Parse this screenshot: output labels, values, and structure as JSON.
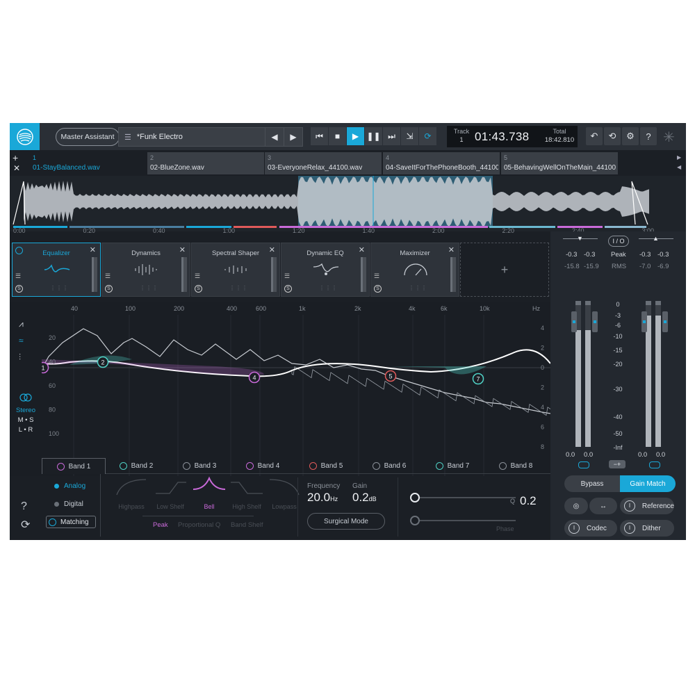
{
  "topbar": {
    "assistant_label": "Master Assistant",
    "preset_name": "*Funk Electro",
    "track_label": "Track",
    "track_num": "1",
    "time": "01:43.738",
    "total_label": "Total",
    "total_time": "18:42.810"
  },
  "tabs": [
    {
      "num": "1",
      "name": "01-StayBalanced.wav",
      "active": true
    },
    {
      "num": "2",
      "name": "02-BlueZone.wav"
    },
    {
      "num": "3",
      "name": "03-EveryoneRelax_44100.wav"
    },
    {
      "num": "4",
      "name": "04-SaveItForThePhoneBooth_44100..."
    },
    {
      "num": "5",
      "name": "05-BehavingWellOnTheMain_44100..."
    }
  ],
  "timeline": [
    "0:00",
    "0:20",
    "0:40",
    "1:00",
    "1:20",
    "1:40",
    "2:00",
    "2:20",
    "2:40",
    "3:00"
  ],
  "modules": [
    {
      "title": "Equalizer",
      "active": true
    },
    {
      "title": "Dynamics"
    },
    {
      "title": "Spectral Shaper"
    },
    {
      "title": "Dynamic EQ"
    },
    {
      "title": "Maximizer"
    }
  ],
  "add_module": "+",
  "eq": {
    "freq_labels": [
      "40",
      "100",
      "200",
      "400",
      "600",
      "1k",
      "2k",
      "4k",
      "6k",
      "10k",
      "Hz"
    ],
    "db_left": [
      "20",
      "40",
      "60",
      "80",
      "100"
    ],
    "db_right": [
      "4",
      "2",
      "0",
      "2",
      "4",
      "6",
      "8"
    ],
    "stereo": "Stereo",
    "ms_row1": "M • S",
    "ms_row2": "L • R",
    "nodes": [
      "1",
      "2",
      "4",
      "5",
      "7"
    ]
  },
  "bands": [
    {
      "label": "Band 1",
      "color": "#c96ad9",
      "active": true
    },
    {
      "label": "Band 2",
      "color": "#4fd1c5"
    },
    {
      "label": "Band 3",
      "color": "#8a9098"
    },
    {
      "label": "Band 4",
      "color": "#c96ad9"
    },
    {
      "label": "Band 5",
      "color": "#e05a5a"
    },
    {
      "label": "Band 6",
      "color": "#8a9098"
    },
    {
      "label": "Band 7",
      "color": "#4fd1c5"
    },
    {
      "label": "Band 8",
      "color": "#8a9098"
    }
  ],
  "controls": {
    "analog": "Analog",
    "digital": "Digital",
    "matching": "Matching",
    "shapes": [
      "Highpass",
      "Low Shelf",
      "Bell",
      "High Shelf",
      "Lowpass"
    ],
    "selected_shape": "Bell",
    "subtypes": [
      "Peak",
      "Proportional Q",
      "Band Shelf"
    ],
    "frequency_label": "Frequency",
    "frequency_value": "20.0",
    "frequency_unit": "Hz",
    "gain_label": "Gain",
    "gain_value": "0.2",
    "gain_unit": "dB",
    "surgical": "Surgical Mode",
    "q_label": "Q",
    "q_value": "0.2",
    "phase_label": "Phase"
  },
  "meters": {
    "io": "I / O",
    "peak": "Peak",
    "rms": "RMS",
    "in_peak": [
      "-0.3",
      "-0.3"
    ],
    "in_rms": [
      "-15.8",
      "-15.9"
    ],
    "out_peak": [
      "-0.3",
      "-0.3"
    ],
    "out_rms": [
      "-7.0",
      "-6.9"
    ],
    "scale": [
      "0",
      "-3",
      "-6",
      "-10",
      "-15",
      "-20",
      "-30",
      "-40",
      "-50",
      "-Inf"
    ],
    "in_bottom": [
      "0.0",
      "0.0"
    ],
    "out_bottom": [
      "0.0",
      "0.0"
    ],
    "in_level": [
      0.8,
      0.8
    ],
    "out_level": [
      0.9,
      0.9
    ]
  },
  "right_buttons": {
    "bypass": "Bypass",
    "gain_match": "Gain Match",
    "reference": "Reference",
    "codec": "Codec",
    "dither": "Dither"
  },
  "colors": {
    "accent": "#1aa8d8",
    "band_purple": "#c96ad9",
    "band_red": "#e05a5a",
    "band_teal": "#4fd1c5"
  }
}
